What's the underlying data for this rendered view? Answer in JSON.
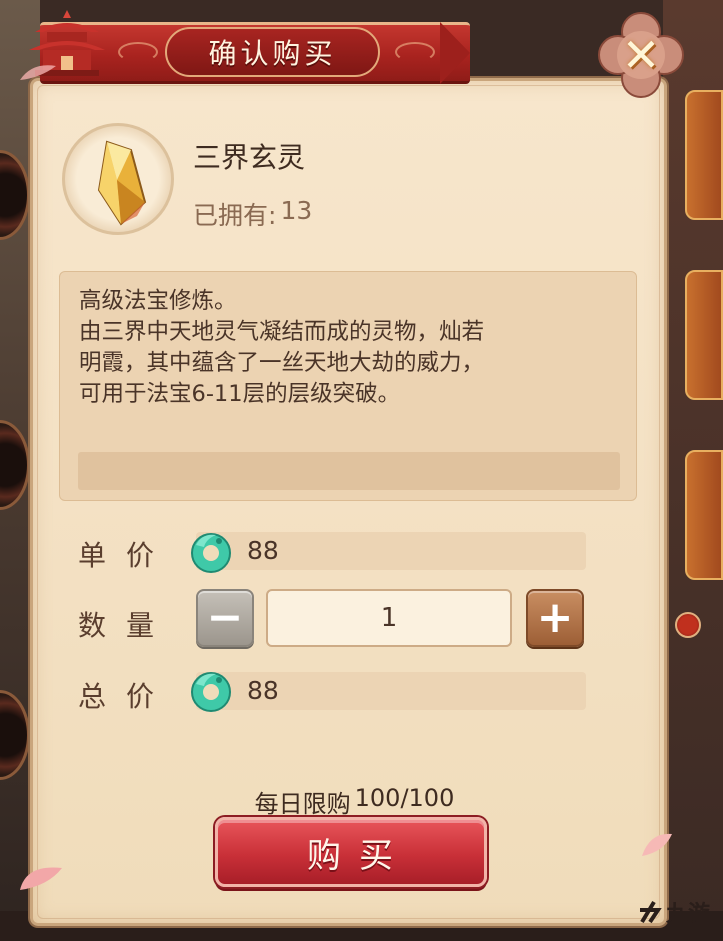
{
  "dialog": {
    "title": "确认购买"
  },
  "item": {
    "name": "三界玄灵",
    "owned_label": "已拥有:",
    "owned_count": "13",
    "icon": "crystal-shard-icon",
    "description": [
      "高级法宝修炼。",
      "由三界中天地灵气凝结而成的灵物，灿若",
      "明霞，其中蕴含了一丝天地大劫的威力，",
      "可用于法宝6-11层的层级突破。"
    ]
  },
  "price": {
    "unit_label": "单价",
    "unit_value": "88",
    "currency_icon": "jade-icon",
    "quantity_label": "数量",
    "quantity_value": "1",
    "minus_label": "−",
    "plus_label": "+",
    "total_label": "总价",
    "total_value": "88"
  },
  "limit": {
    "label": "每日限购",
    "value": "100/100"
  },
  "buy_button": {
    "label": "购买"
  },
  "watermark": {
    "text": "九游"
  },
  "colors": {
    "panel_bg": "#f7e6cc",
    "banner_red": "#a9231f",
    "buy_red": "#c93038",
    "jade_green": "#3fc9a8",
    "text_brown": "#4a3428"
  }
}
